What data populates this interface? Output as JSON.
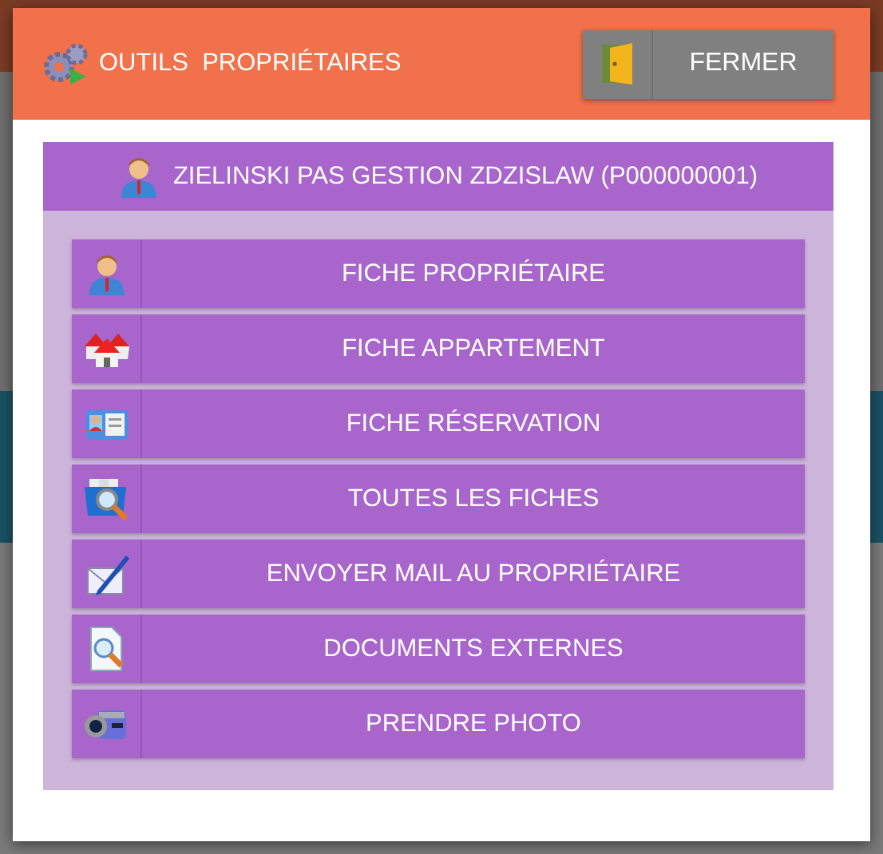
{
  "dialog": {
    "title": "OUTILS  PROPRIÉTAIRES",
    "close_button": "FERMER"
  },
  "owner": {
    "label": "ZIELINSKI PAS GESTION ZDZISLAW (P000000001)"
  },
  "actions": [
    {
      "kind": "person",
      "label": "FICHE PROPRIÉTAIRE"
    },
    {
      "kind": "houses",
      "label": "FICHE APPARTEMENT"
    },
    {
      "kind": "card",
      "label": "FICHE RÉSERVATION"
    },
    {
      "kind": "folder",
      "label": "TOUTES LES FICHES"
    },
    {
      "kind": "mail",
      "label": "ENVOYER MAIL AU PROPRIÉTAIRE"
    },
    {
      "kind": "document",
      "label": "DOCUMENTS EXTERNES"
    },
    {
      "kind": "camera",
      "label": "PRENDRE PHOTO"
    }
  ]
}
